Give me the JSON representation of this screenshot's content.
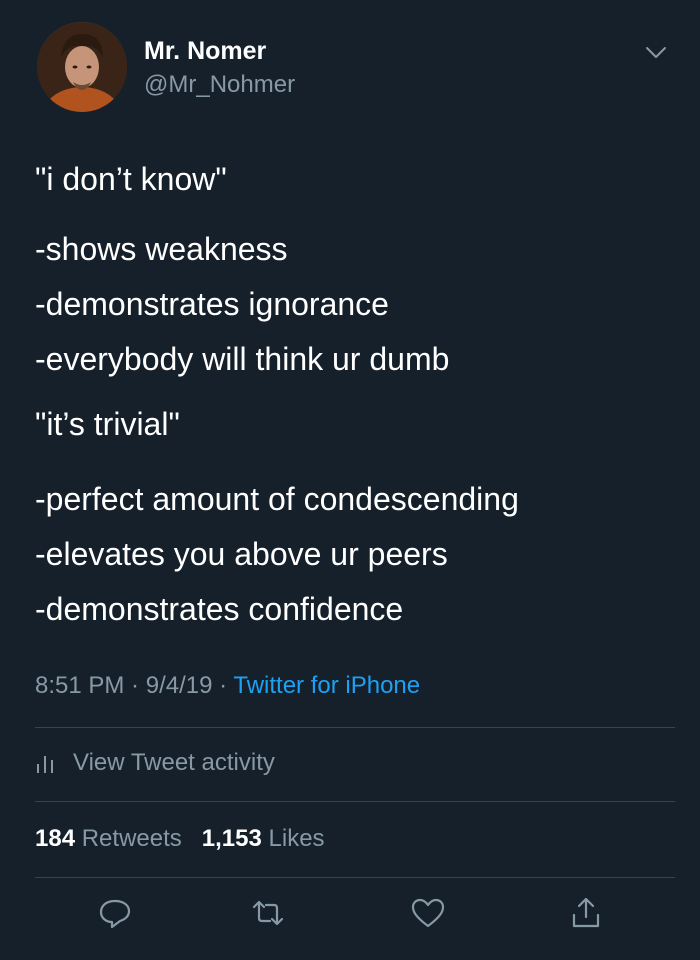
{
  "author": {
    "display_name": "Mr. Nomer",
    "handle": "@Mr_Nohmer"
  },
  "tweet": {
    "lines": [
      "\"i don’t know\"",
      "-shows weakness",
      "-demonstrates ignorance",
      "-everybody will think ur dumb",
      "\"it’s trivial\"",
      "-perfect amount of condescending",
      "-elevates you above ur peers",
      "-demonstrates confidence"
    ]
  },
  "meta": {
    "time": "8:51 PM",
    "sep1": " · ",
    "date": "9/4/19",
    "sep2": " · ",
    "source": "Twitter for iPhone"
  },
  "activity": {
    "label": "View Tweet activity",
    "icon": "bar-chart-icon"
  },
  "stats": {
    "retweets_count": "184",
    "retweets_label": "Retweets",
    "likes_count": "1,153",
    "likes_label": "Likes"
  },
  "actions": [
    "reply-icon",
    "retweet-icon",
    "like-icon",
    "share-icon"
  ],
  "colors": {
    "background": "#15202b",
    "text": "#ffffff",
    "secondary": "#8899a6",
    "accent": "#1da1f2",
    "divider": "#38444d"
  }
}
